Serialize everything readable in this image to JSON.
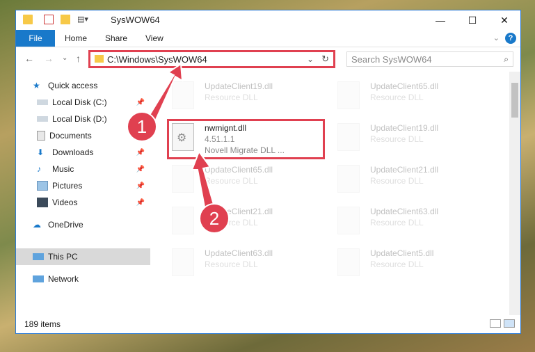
{
  "window": {
    "title": "SysWOW64"
  },
  "ribbon": {
    "file": "File",
    "home": "Home",
    "share": "Share",
    "view": "View",
    "help": "?"
  },
  "address": {
    "path": "C:\\Windows\\SysWOW64"
  },
  "search": {
    "placeholder": "Search SysWOW64"
  },
  "sidebar": {
    "items": [
      {
        "label": "Quick access"
      },
      {
        "label": "Local Disk (C:)"
      },
      {
        "label": "Local Disk (D:)"
      },
      {
        "label": "Documents"
      },
      {
        "label": "Downloads"
      },
      {
        "label": "Music"
      },
      {
        "label": "Pictures"
      },
      {
        "label": "Videos"
      },
      {
        "label": "OneDrive"
      },
      {
        "label": "This PC"
      },
      {
        "label": "Network"
      }
    ]
  },
  "files": {
    "highlighted": {
      "name": "nwmignt.dll",
      "version": "4.51.1.1",
      "desc": "Novell Migrate DLL ..."
    },
    "faded": [
      {
        "name": "UpdateClient19.dll",
        "type": "Resource DLL"
      },
      {
        "name": "UpdateClient65.dll",
        "type": "Resource DLL"
      },
      {
        "name": "UpdateClient19.dll",
        "type": "Resource DLL"
      },
      {
        "name": "UpdateClient65.dll",
        "type": "Resource DLL"
      },
      {
        "name": "UpdateClient21.dll",
        "type": "Resource DLL"
      },
      {
        "name": "UpdateClient21.dll",
        "type": "Resource DLL"
      },
      {
        "name": "UpdateClient63.dll",
        "type": "Resource DLL"
      },
      {
        "name": "UpdateClient63.dll",
        "type": "Resource DLL"
      },
      {
        "name": "UpdateClient5.dll",
        "type": "Resource DLL"
      }
    ]
  },
  "status": {
    "items": "189 items"
  },
  "annotations": {
    "one": "1",
    "two": "2"
  },
  "colors": {
    "accent": "#1979ca",
    "highlight": "#e04050"
  }
}
